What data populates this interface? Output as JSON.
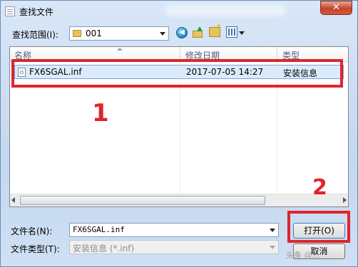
{
  "window": {
    "title": "查找文件",
    "close_glyph": "✕"
  },
  "toolbar": {
    "lookin_label": "查找范围(I):",
    "lookin_value": "001",
    "icons": [
      "back-icon",
      "up-folder-icon",
      "new-folder-icon",
      "view-menu-icon"
    ]
  },
  "filelist": {
    "columns": [
      "名称",
      "修改日期",
      "类型"
    ],
    "rows": [
      {
        "name": "FX6SGAL.inf",
        "modified": "2017-07-05 14:27",
        "type": "安装信息"
      }
    ]
  },
  "annotations": {
    "marker_1": "1",
    "marker_2": "2",
    "color": "#e0242c"
  },
  "filename": {
    "label": "文件名(N):",
    "value": "FX6SGAL.inf"
  },
  "filetype": {
    "label": "文件类型(T):",
    "value": "安装信息 (*.inf)"
  },
  "buttons": {
    "open": "打开(O)",
    "cancel": "取消"
  },
  "watermark": "头条 @..."
}
